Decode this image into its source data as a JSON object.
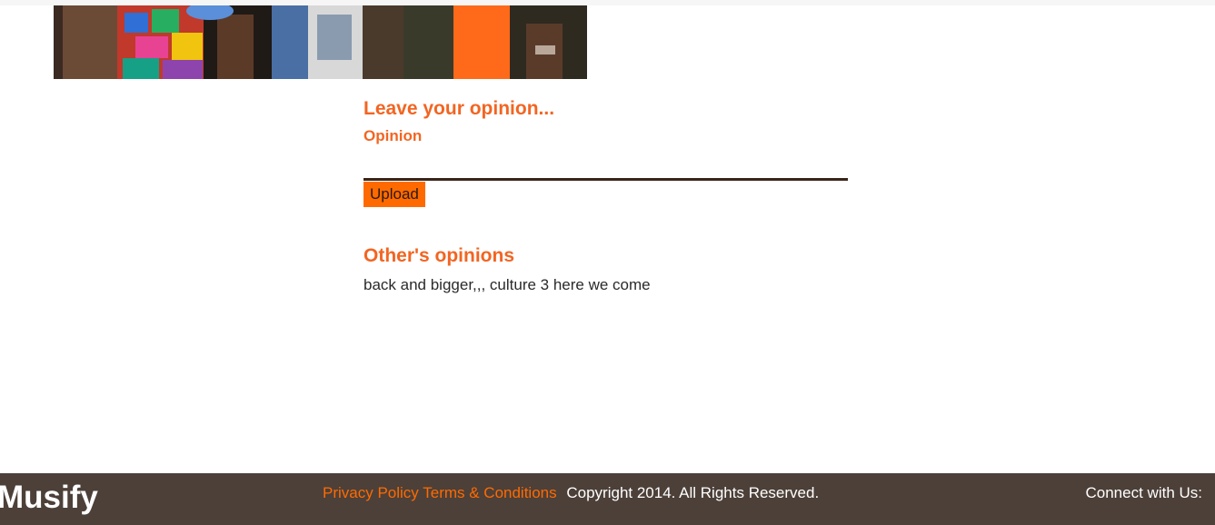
{
  "opinion_form": {
    "heading": "Leave your opinion...",
    "field_label": "Opinion",
    "field_value": "",
    "upload_label": "Upload"
  },
  "others": {
    "heading": "Other's opinions",
    "items": [
      "back and bigger,,, culture 3 here we come"
    ]
  },
  "footer": {
    "brand": "Musify",
    "privacy_label": "Privacy Policy",
    "terms_label": "Terms & Conditions",
    "copyright": "Copyright 2014.  All Rights Reserved.",
    "connect": "Connect with Us:"
  },
  "colors": {
    "accent": "#f26522",
    "button": "#ff6a00",
    "footer_bg": "#4c4039"
  }
}
